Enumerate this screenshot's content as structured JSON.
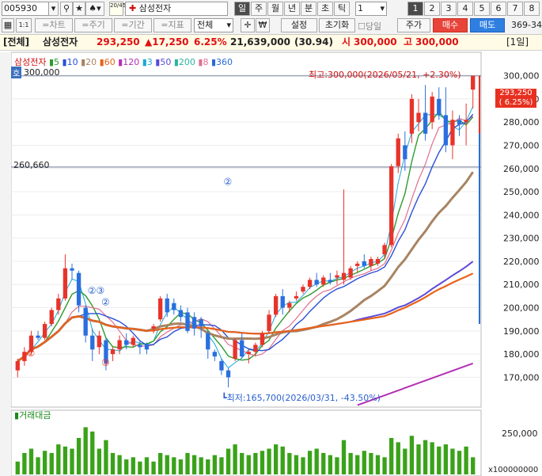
{
  "toolbar": {
    "code": "005930",
    "search_icon": "search-icon",
    "star_icon": "star-icon",
    "arrow_icon": "up-down-icon",
    "stock_badge": "20/45",
    "stock_name": "삼성전자",
    "period_tabs": [
      "일",
      "주",
      "월",
      "년",
      "분",
      "초",
      "틱"
    ],
    "period_selected": "일",
    "interval_value": "1",
    "page_numbers": [
      "1",
      "2",
      "3",
      "4",
      "5",
      "6",
      "7",
      "8"
    ]
  },
  "toolbar2": {
    "sidebar_toggle": "1:1",
    "buttons": [
      "=차트",
      "=주기",
      "=기간",
      "=지표"
    ],
    "range_select": "전체",
    "settings": "설정",
    "reset": "초기화",
    "same_day": "당일",
    "price": "주가",
    "buy": "매수",
    "sell": "매도",
    "right_code": "369-34"
  },
  "infobar": {
    "tag": "[전체]",
    "name": "삼성전자",
    "price": "293,250",
    "change": "▲17,250",
    "pct": "6.25%",
    "volume": "21,639,000",
    "ratio": "(30.94)",
    "open_label": "시",
    "open": "300,000",
    "high_label": "고",
    "high": "300,000",
    "view": "[1일]"
  },
  "legend": {
    "name": "삼성전자",
    "items": [
      {
        "label": "5",
        "color": "#2e9b2e"
      },
      {
        "label": "10",
        "color": "#2a4fd8"
      },
      {
        "label": "20",
        "color": "#a88462"
      },
      {
        "label": "60",
        "color": "#e8621a"
      },
      {
        "label": "120",
        "color": "#b42fb4"
      },
      {
        "label": "3",
        "color": "#1aa8d8"
      },
      {
        "label": "50",
        "color": "#5b4bd6"
      },
      {
        "label": "200",
        "color": "#2bb3a0"
      },
      {
        "label": "8",
        "color": "#e07090"
      },
      {
        "label": "360",
        "color": "#2a6ad8"
      }
    ]
  },
  "chart_annotations": {
    "top_left_value": "300,000",
    "top_left_tag": "호",
    "hline_value": "260,660",
    "high_label": "최고:300,000(2026/05/21, +2.30%)",
    "low_label": "최저:165,700(2026/03/31, -43.50%)",
    "price_box_value": "293,250",
    "price_box_pct": "( 6.25%)",
    "wave_marks": [
      "②",
      "②③",
      "②",
      "③",
      "②"
    ]
  },
  "chart_data": {
    "type": "candlestick",
    "y_ticks": [
      170000,
      180000,
      190000,
      200000,
      210000,
      220000,
      230000,
      240000,
      250000,
      260000,
      270000,
      280000,
      290000,
      300000
    ],
    "y_range": [
      164000,
      306000
    ],
    "candles": [
      {
        "o": 173000,
        "h": 178000,
        "l": 170000,
        "c": 177000
      },
      {
        "o": 177000,
        "h": 183000,
        "l": 175000,
        "c": 181000
      },
      {
        "o": 181000,
        "h": 190000,
        "l": 180000,
        "c": 188000
      },
      {
        "o": 188000,
        "h": 190000,
        "l": 186000,
        "c": 187000
      },
      {
        "o": 187000,
        "h": 194000,
        "l": 186000,
        "c": 193000
      },
      {
        "o": 193000,
        "h": 200000,
        "l": 192000,
        "c": 199000
      },
      {
        "o": 199000,
        "h": 206000,
        "l": 197000,
        "c": 204000
      },
      {
        "o": 204000,
        "h": 223000,
        "l": 203000,
        "c": 217000
      },
      {
        "o": 217000,
        "h": 219000,
        "l": 212000,
        "c": 216000
      },
      {
        "o": 215000,
        "h": 216000,
        "l": 198000,
        "c": 201000
      },
      {
        "o": 200000,
        "h": 201000,
        "l": 185000,
        "c": 188000
      },
      {
        "o": 188000,
        "h": 191000,
        "l": 177000,
        "c": 182000
      },
      {
        "o": 183000,
        "h": 190000,
        "l": 180000,
        "c": 188000
      },
      {
        "o": 186000,
        "h": 187000,
        "l": 173000,
        "c": 176000
      },
      {
        "o": 180000,
        "h": 183000,
        "l": 177000,
        "c": 182000
      },
      {
        "o": 182000,
        "h": 188000,
        "l": 180000,
        "c": 186000
      },
      {
        "o": 186000,
        "h": 189000,
        "l": 182000,
        "c": 184000
      },
      {
        "o": 184000,
        "h": 188000,
        "l": 183000,
        "c": 187000
      },
      {
        "o": 184000,
        "h": 186000,
        "l": 180000,
        "c": 183000
      },
      {
        "o": 184000,
        "h": 185000,
        "l": 180000,
        "c": 182000
      },
      {
        "o": 191000,
        "h": 193000,
        "l": 189000,
        "c": 192000
      },
      {
        "o": 195000,
        "h": 205000,
        "l": 194000,
        "c": 204000
      },
      {
        "o": 204000,
        "h": 206000,
        "l": 196000,
        "c": 198000
      },
      {
        "o": 202000,
        "h": 204000,
        "l": 197000,
        "c": 199000
      },
      {
        "o": 199000,
        "h": 201000,
        "l": 194000,
        "c": 196000
      },
      {
        "o": 198000,
        "h": 200000,
        "l": 189000,
        "c": 190000
      },
      {
        "o": 196000,
        "h": 198000,
        "l": 188000,
        "c": 191000
      },
      {
        "o": 195000,
        "h": 196000,
        "l": 187000,
        "c": 192000
      },
      {
        "o": 189000,
        "h": 190000,
        "l": 178000,
        "c": 182000
      },
      {
        "o": 181000,
        "h": 182000,
        "l": 177000,
        "c": 179000
      },
      {
        "o": 177000,
        "h": 178000,
        "l": 171000,
        "c": 173000
      },
      {
        "o": 173000,
        "h": 174000,
        "l": 165700,
        "c": 170000
      },
      {
        "o": 178000,
        "h": 187000,
        "l": 177000,
        "c": 186000
      },
      {
        "o": 186000,
        "h": 189000,
        "l": 178000,
        "c": 179000
      },
      {
        "o": 180000,
        "h": 182000,
        "l": 176000,
        "c": 181000
      },
      {
        "o": 181000,
        "h": 185000,
        "l": 179000,
        "c": 184000
      },
      {
        "o": 184000,
        "h": 190000,
        "l": 183000,
        "c": 189000
      },
      {
        "o": 190000,
        "h": 199000,
        "l": 189000,
        "c": 197000
      },
      {
        "o": 197000,
        "h": 206000,
        "l": 196000,
        "c": 205000
      },
      {
        "o": 205000,
        "h": 208000,
        "l": 197000,
        "c": 200000
      },
      {
        "o": 200000,
        "h": 203000,
        "l": 198000,
        "c": 202000
      },
      {
        "o": 204000,
        "h": 207000,
        "l": 203000,
        "c": 205000
      },
      {
        "o": 207000,
        "h": 210000,
        "l": 206000,
        "c": 209000
      },
      {
        "o": 209000,
        "h": 213000,
        "l": 208000,
        "c": 212000
      },
      {
        "o": 212000,
        "h": 215000,
        "l": 209000,
        "c": 210000
      },
      {
        "o": 210000,
        "h": 214000,
        "l": 209000,
        "c": 213000
      },
      {
        "o": 212000,
        "h": 215000,
        "l": 210000,
        "c": 211000
      },
      {
        "o": 213000,
        "h": 216000,
        "l": 210000,
        "c": 214000
      },
      {
        "o": 212000,
        "h": 251000,
        "l": 210000,
        "c": 215000
      },
      {
        "o": 213000,
        "h": 218000,
        "l": 212000,
        "c": 217000
      },
      {
        "o": 218000,
        "h": 220000,
        "l": 215000,
        "c": 219000
      },
      {
        "o": 220000,
        "h": 223000,
        "l": 217000,
        "c": 218000
      },
      {
        "o": 218000,
        "h": 222000,
        "l": 216000,
        "c": 221000
      },
      {
        "o": 219000,
        "h": 222000,
        "l": 218000,
        "c": 221000
      },
      {
        "o": 223000,
        "h": 228000,
        "l": 221000,
        "c": 227000
      },
      {
        "o": 227000,
        "h": 262000,
        "l": 226000,
        "c": 261000
      },
      {
        "o": 261000,
        "h": 275000,
        "l": 258000,
        "c": 273000
      },
      {
        "o": 270000,
        "h": 276000,
        "l": 259000,
        "c": 264000
      },
      {
        "o": 275000,
        "h": 292000,
        "l": 271000,
        "c": 290000
      },
      {
        "o": 280000,
        "h": 290000,
        "l": 276000,
        "c": 284000
      },
      {
        "o": 284000,
        "h": 296000,
        "l": 272000,
        "c": 275000
      },
      {
        "o": 280000,
        "h": 293000,
        "l": 277000,
        "c": 291000
      },
      {
        "o": 290000,
        "h": 295000,
        "l": 281000,
        "c": 283000
      },
      {
        "o": 283000,
        "h": 295000,
        "l": 267000,
        "c": 270000
      },
      {
        "o": 270000,
        "h": 285000,
        "l": 264000,
        "c": 281000
      },
      {
        "o": 281000,
        "h": 283000,
        "l": 274000,
        "c": 279000
      },
      {
        "o": 280000,
        "h": 288000,
        "l": 270000,
        "c": 281000
      },
      {
        "o": 294000,
        "h": 300000,
        "l": 286000,
        "c": 300000
      }
    ],
    "volume": [
      6,
      10,
      12,
      8,
      11,
      10,
      14,
      13,
      12,
      17,
      22,
      20,
      12,
      16,
      10,
      9,
      7,
      8,
      6,
      8,
      6,
      10,
      9,
      8,
      7,
      10,
      9,
      8,
      7,
      9,
      8,
      12,
      14,
      10,
      9,
      10,
      11,
      12,
      14,
      13,
      10,
      9,
      8,
      11,
      12,
      10,
      9,
      8,
      16,
      10,
      9,
      11,
      10,
      9,
      8,
      17,
      15,
      12,
      18,
      14,
      16,
      15,
      13,
      14,
      12,
      11,
      13,
      8
    ]
  },
  "volume_panel": {
    "title": "거래대금",
    "tick": "250,000",
    "unit": "x100000000"
  }
}
